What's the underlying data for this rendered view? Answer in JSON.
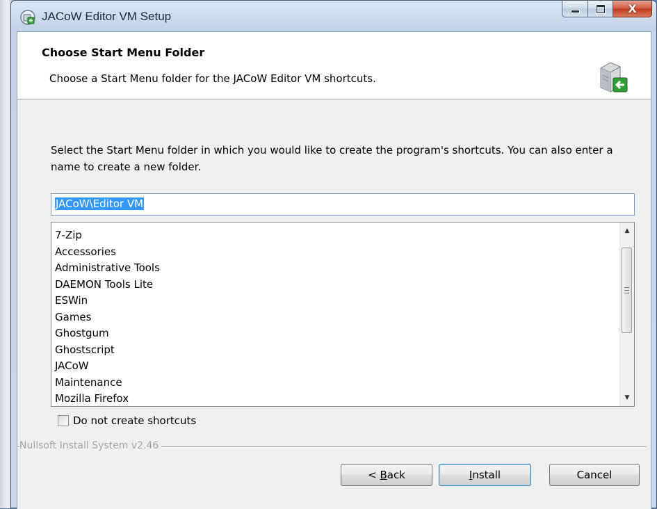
{
  "window": {
    "title": "JACoW Editor VM Setup",
    "icon": "installer-icon",
    "caption_buttons": {
      "minimize_icon": "minimize-icon",
      "maximize_icon": "maximize-icon",
      "close_label": "X"
    }
  },
  "header": {
    "title": "Choose Start Menu Folder",
    "subtitle": "Choose a Start Menu folder for the JACoW Editor VM shortcuts.",
    "icon": "start-menu-folder-icon"
  },
  "body": {
    "description": "Select the Start Menu folder in which you would like to create the program's shortcuts. You can also enter a name to create a new folder.",
    "folder_input_value": "JACoW\\Editor VM",
    "folders": [
      "7-Zip",
      "Accessories",
      "Administrative Tools",
      "DAEMON Tools Lite",
      "ESWin",
      "Games",
      "Ghostgum",
      "Ghostscript",
      "JACoW",
      "Maintenance",
      "Mozilla Firefox"
    ],
    "no_shortcuts_label": "Do not create shortcuts",
    "no_shortcuts_checked": false
  },
  "footer": {
    "branding": "Nullsoft Install System v2.46",
    "back_prefix": "< ",
    "back_accel": "B",
    "back_rest": "ack",
    "install_accel": "I",
    "install_rest": "nstall",
    "cancel_label": "Cancel"
  },
  "colors": {
    "selection": "#3399ff",
    "primary_button_border": "#3c7fb1",
    "close_button": "#c03a1c"
  }
}
